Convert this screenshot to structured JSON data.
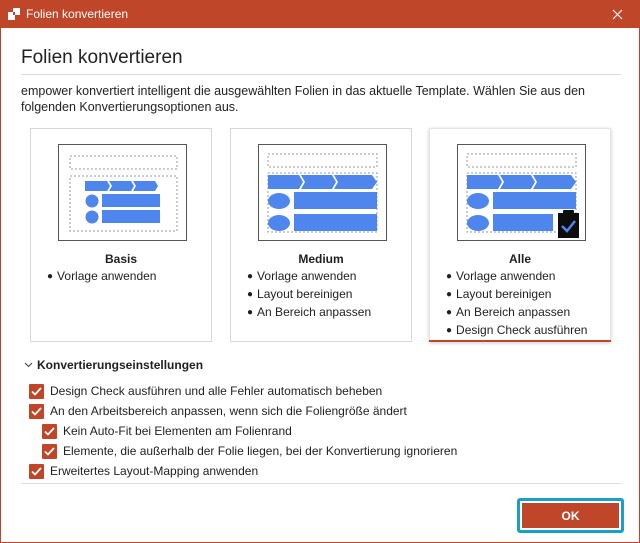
{
  "window": {
    "title": "Folien konvertieren"
  },
  "heading": "Folien konvertieren",
  "description": "empower konvertiert intelligent die ausgewählten Folien in das aktuelle Template. Wählen Sie aus den folgenden Konvertierungsoptionen aus.",
  "cards": [
    {
      "title": "Basis",
      "items": [
        "Vorlage anwenden"
      ],
      "selected": false
    },
    {
      "title": "Medium",
      "items": [
        "Vorlage anwenden",
        "Layout bereinigen",
        "An Bereich anpassen"
      ],
      "selected": false
    },
    {
      "title": "Alle",
      "items": [
        "Vorlage anwenden",
        "Layout bereinigen",
        "An Bereich anpassen",
        "Design Check ausführen"
      ],
      "selected": true
    }
  ],
  "settings": {
    "header": "Konvertierungseinstellungen",
    "options": [
      {
        "label": "Design Check ausführen und alle Fehler automatisch beheben",
        "checked": true
      },
      {
        "label": "An den Arbeitsbereich anpassen, wenn sich die Foliengröße ändert",
        "checked": true
      },
      {
        "label": "Kein Auto-Fit bei Elementen am Folienrand",
        "checked": true
      },
      {
        "label": "Elemente, die außerhalb der Folie liegen, bei der Konvertierung ignorieren",
        "checked": true
      },
      {
        "label": "Erweitertes Layout-Mapping anwenden",
        "checked": true
      }
    ]
  },
  "ok_label": "OK",
  "colors": {
    "accent": "#c0462a",
    "focus": "#18a0c8",
    "shape_blue": "#4f86ee"
  }
}
